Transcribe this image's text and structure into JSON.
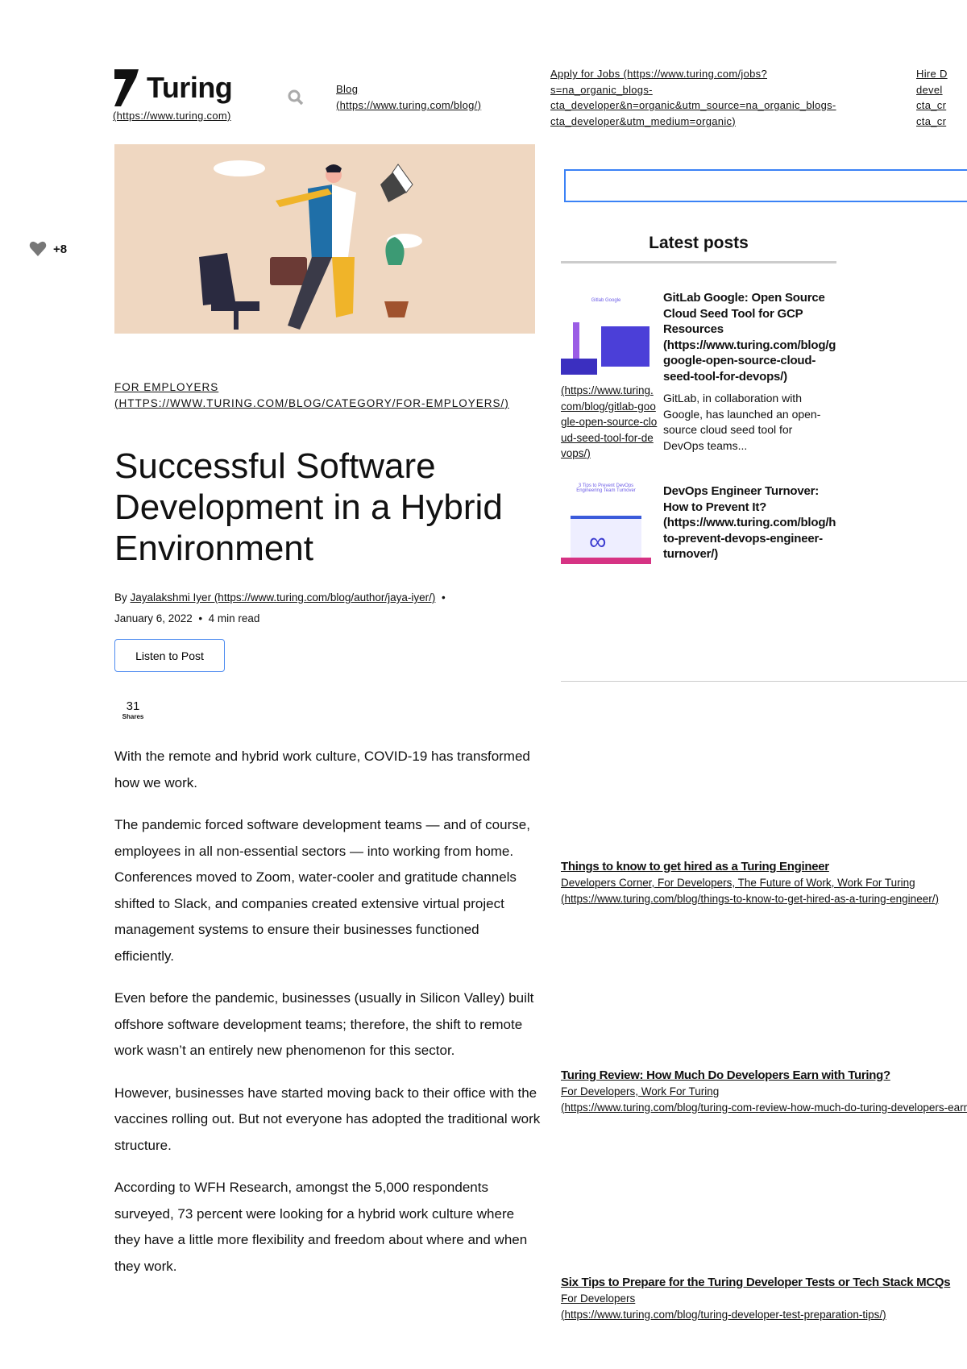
{
  "header": {
    "logo_text": "Turing",
    "logo_url": "(https://www.turing.com)",
    "blog_label": "Blog",
    "blog_url": "(https://www.turing.com/blog/)",
    "apply_lines": [
      "Apply for Jobs (https://www.turing.com/jobs?",
      "s=na_organic_blogs-",
      "cta_developer&n=organic&utm_source=na_organic_blogs-",
      "cta_developer&utm_medium=organic)"
    ],
    "hire_lines": [
      "Hire D",
      "devel",
      "cta_cr",
      "cta_cr"
    ]
  },
  "like": {
    "count": "+8"
  },
  "article": {
    "category": "FOR EMPLOYERS",
    "category_url": "(HTTPS://WWW.TURING.COM/BLOG/CATEGORY/FOR-EMPLOYERS/)",
    "title": "Successful Software Development in a Hybrid Environment",
    "by": "By",
    "author": "Jayalakshmi Iyer (https://www.turing.com/blog/author/jaya-iyer/)",
    "date": "January 6, 2022",
    "read_time": "4 min read",
    "listen_label": "Listen to Post",
    "shares_count": "31",
    "shares_label": "Shares",
    "paragraphs": [
      "With the remote and hybrid work culture, COVID-19 has transformed how we work.",
      "The pandemic forced software development teams — and of course, employees in all non-essential sectors — into working from home. Conferences moved to Zoom, water-cooler and gratitude channels shifted to Slack, and companies created extensive virtual project management systems to ensure their businesses functioned efficiently.",
      "Even before the pandemic, businesses (usually in Silicon Valley) built offshore software development teams; therefore, the shift to remote work wasn’t an entirely new phenomenon for this sector.",
      "However, businesses have started moving back to their office with the vaccines rolling out. But not everyone has adopted the traditional work structure.",
      "According to WFH Research, amongst the 5,000 respondents surveyed, 73 percent were looking for a hybrid work culture where they have a little more flexibility and freedom about where and when they work."
    ]
  },
  "sidebar": {
    "search_value": "",
    "latest_title": "Latest posts",
    "posts": [
      {
        "title": "GitLab    Google: Open Source Cloud Seed Tool for GCP Resources (https://www.turing.com/blog/gitlab-google-open-source-cloud-seed-tool-for-devops/)",
        "img_link": "(https://www.turing.com/blog/gitlab-google-open-source-cloud-seed-tool-for-devops/)",
        "excerpt": "GitLab, in collaboration with Google, has launched an open-source cloud seed tool for DevOps teams...",
        "img_caption": "Gitlab Google"
      },
      {
        "title": "DevOps Engineer Turnover: How to Prevent It? (https://www.turing.com/blog/how-to-prevent-devops-engineer-turnover/)",
        "img_caption": "3 Tips to Prevent DevOps Engineering Team Turnover"
      }
    ],
    "related": [
      {
        "title": "Things to know to get hired as a Turing Engineer",
        "cats": "Developers Corner, For Developers, The Future of Work, Work For Turing",
        "url": "(https://www.turing.com/blog/things-to-know-to-get-hired-as-a-turing-engineer/)"
      },
      {
        "title": "Turing Review: How Much Do Developers Earn with Turing?",
        "cats": "For Developers, Work For Turing",
        "url": "(https://www.turing.com/blog/turing-com-review-how-much-do-turing-developers-earn/)"
      },
      {
        "title": "Six Tips to Prepare for the Turing Developer Tests or Tech Stack MCQs",
        "cats": "For Developers",
        "url": "(https://www.turing.com/blog/turing-developer-test-preparation-tips/)"
      }
    ]
  }
}
